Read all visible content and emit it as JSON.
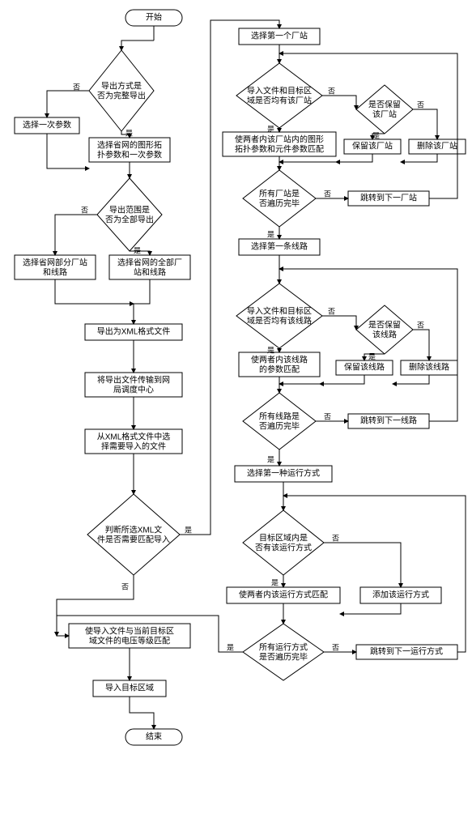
{
  "terminal": {
    "start": "开始",
    "end": "结束"
  },
  "labels": {
    "yes": "是",
    "no": "否"
  },
  "left": {
    "d1": {
      "l1": "导出方式是",
      "l2": "否为完整导出"
    },
    "b1": "选择一次参数",
    "b2": {
      "l1": "选择省网的图形拓",
      "l2": "扑参数和一次参数"
    },
    "d2": {
      "l1": "导出范围是",
      "l2": "否为全部导出"
    },
    "b3": {
      "l1": "选择省网部分厂站",
      "l2": "和线路"
    },
    "b4": {
      "l1": "选择省网的全部厂",
      "l2": "站和线路"
    },
    "b5": "导出为XML格式文件",
    "b6": {
      "l1": "将导出文件传输到网",
      "l2": "局调度中心"
    },
    "b7": {
      "l1": "从XML格式文件中选",
      "l2": "择需要导入的文件"
    },
    "d3": {
      "l1": "判断所选XML文",
      "l2": "件是否需要匹配导入"
    },
    "b8": {
      "l1": "使导入文件与当前目标区",
      "l2": "域文件的电压等级匹配"
    },
    "b9": "导入目标区域"
  },
  "right": {
    "b10": "选择第一个厂站",
    "d4": {
      "l1": "导入文件和目标区",
      "l2": "域是否均有该厂站"
    },
    "d5": {
      "l1": "是否保留",
      "l2": "该厂站"
    },
    "b11": {
      "l1": "使两者内该厂站内的图形",
      "l2": "拓扑参数和元件参数匹配"
    },
    "b12": "保留该厂站",
    "b13": "删除该厂站",
    "d6": {
      "l1": "所有厂站是",
      "l2": "否遍历完毕"
    },
    "b14": "跳转到下一厂站",
    "b15": "选择第一条线路",
    "d7": {
      "l1": "导入文件和目标区",
      "l2": "域是否均有该线路"
    },
    "d8": {
      "l1": "是否保留",
      "l2": "该线路"
    },
    "b16": {
      "l1": "使两者内该线路",
      "l2": "的参数匹配"
    },
    "b17": "保留该线路",
    "b18": "删除该线路",
    "d9": {
      "l1": "所有线路是",
      "l2": "否遍历完毕"
    },
    "b19": "跳转到下一线路",
    "b20": "选择第一种运行方式",
    "d10": {
      "l1": "目标区域内是",
      "l2": "否有该运行方式"
    },
    "b21": "使两者内该运行方式匹配",
    "b22": "添加该运行方式",
    "d11": {
      "l1": "所有运行方式",
      "l2": "是否遍历完毕"
    },
    "b23": "跳转到下一运行方式"
  }
}
